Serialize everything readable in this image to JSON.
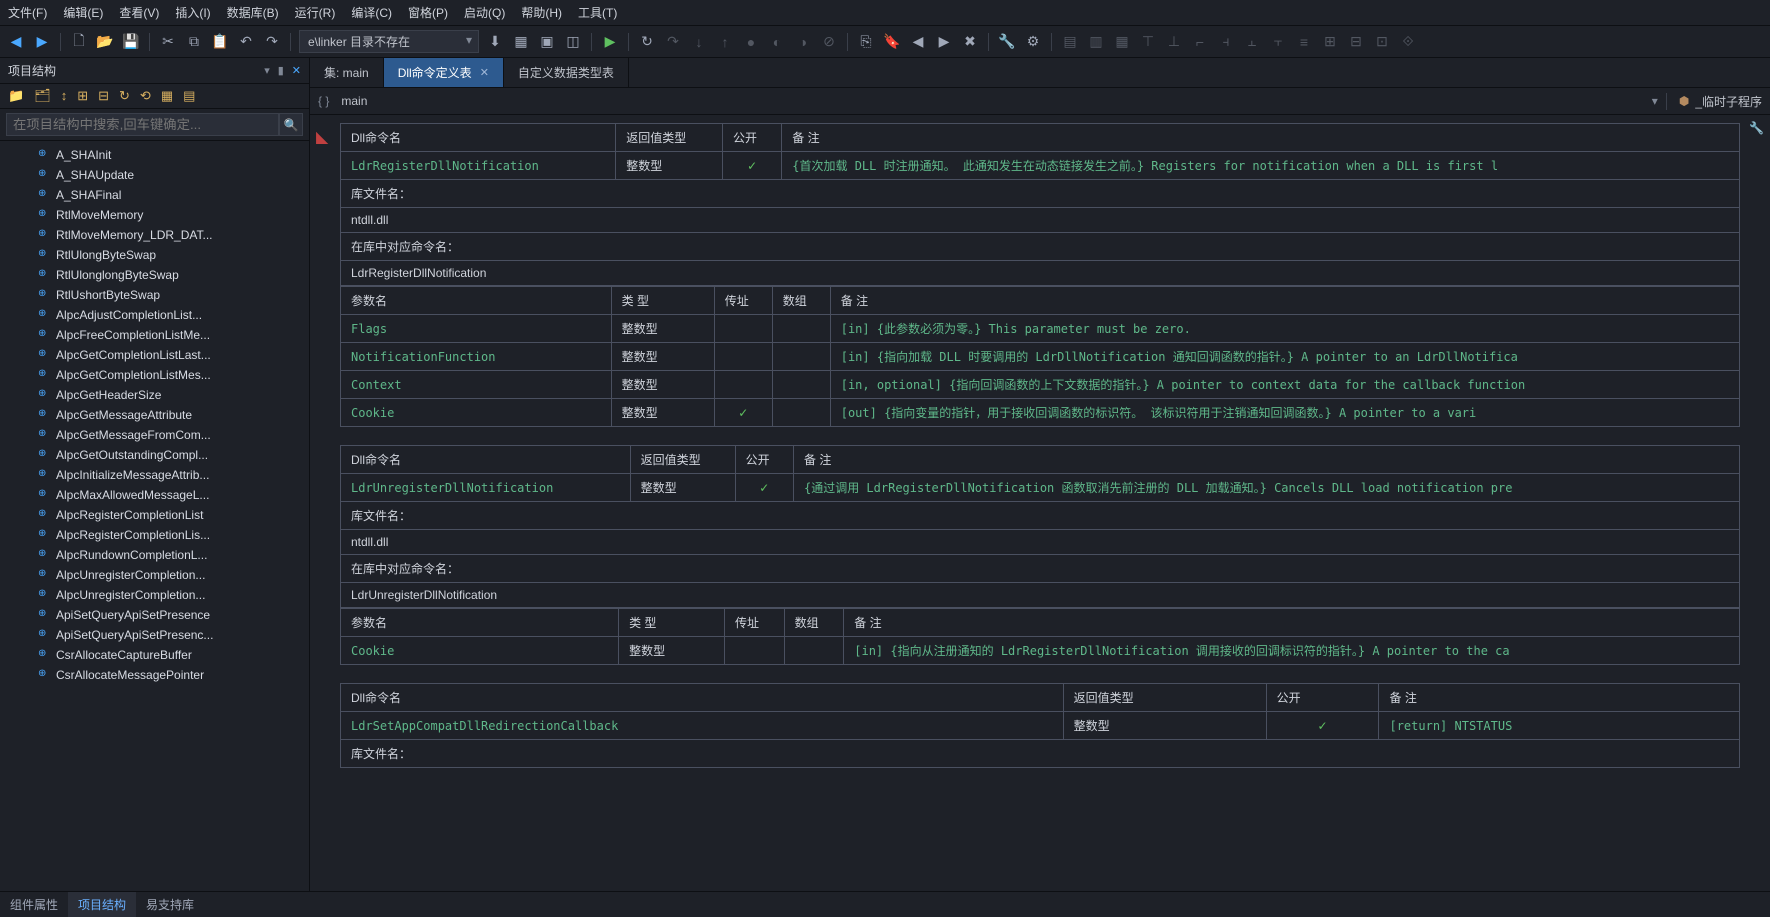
{
  "menu": [
    "文件(F)",
    "编辑(E)",
    "查看(V)",
    "插入(I)",
    "数据库(B)",
    "运行(R)",
    "编译(C)",
    "窗格(P)",
    "启动(Q)",
    "帮助(H)",
    "工具(T)"
  ],
  "toolbar": {
    "path_value": "e\\linker 目录不存在"
  },
  "sidebar": {
    "title": "项目结构",
    "search_placeholder": "在项目结构中搜索,回车键确定...",
    "items": [
      "A_SHAInit",
      "A_SHAUpdate",
      "A_SHAFinal",
      "RtlMoveMemory",
      "RtlMoveMemory_LDR_DAT...",
      "RtlUlongByteSwap",
      "RtlUlonglongByteSwap",
      "RtlUshortByteSwap",
      "AlpcAdjustCompletionList...",
      "AlpcFreeCompletionListMe...",
      "AlpcGetCompletionListLast...",
      "AlpcGetCompletionListMes...",
      "AlpcGetHeaderSize",
      "AlpcGetMessageAttribute",
      "AlpcGetMessageFromCom...",
      "AlpcGetOutstandingCompl...",
      "AlpcInitializeMessageAttrib...",
      "AlpcMaxAllowedMessageL...",
      "AlpcRegisterCompletionList",
      "AlpcRegisterCompletionLis...",
      "AlpcRundownCompletionL...",
      "AlpcUnregisterCompletion...",
      "AlpcUnregisterCompletion...",
      "ApiSetQueryApiSetPresence",
      "ApiSetQueryApiSetPresenc...",
      "CsrAllocateCaptureBuffer",
      "CsrAllocateMessagePointer"
    ]
  },
  "bottom_tabs": [
    "组件属性",
    "项目结构",
    "易支持库"
  ],
  "bottom_active": 1,
  "editor_tabs": [
    {
      "label": "集: main",
      "active": false
    },
    {
      "label": "Dll命令定义表",
      "active": true,
      "closeable": true
    },
    {
      "label": "自定义数据类型表",
      "active": false
    }
  ],
  "breadcrumb": {
    "left": "main",
    "right": "_临时子程序"
  },
  "headers": {
    "dll_name": "Dll命令名",
    "ret_type": "返回值类型",
    "public": "公开",
    "remark": "备 注",
    "lib_file": "库文件名：",
    "lib_symbol": "在库中对应命令名：",
    "param_name": "参数名",
    "param_type": "类 型",
    "by_addr": "传址",
    "array": "数组"
  },
  "blocks": [
    {
      "cmd": "LdrRegisterDllNotification",
      "ret": "整数型",
      "pub": true,
      "remark": "{首次加载 DLL 时注册通知。 此通知发生在动态链接发生之前。} Registers for notification when a DLL is first l",
      "lib": "ntdll.dll",
      "symbol": "LdrRegisterDllNotification",
      "params": [
        {
          "name": "Flags",
          "type": "整数型",
          "addr": false,
          "arr": false,
          "remark": "[in] {此参数必须为零。} This parameter must be zero."
        },
        {
          "name": "NotificationFunction",
          "type": "整数型",
          "addr": false,
          "arr": false,
          "remark": "[in] {指向加载 DLL 时要调用的 LdrDllNotification 通知回调函数的指针。} A pointer to an LdrDllNotifica"
        },
        {
          "name": "Context",
          "type": "整数型",
          "addr": false,
          "arr": false,
          "remark": "[in, optional] {指向回调函数的上下文数据的指针。} A pointer to context data for the callback function"
        },
        {
          "name": "Cookie",
          "type": "整数型",
          "addr": true,
          "arr": false,
          "remark": "[out] {指向变量的指针，用于接收回调函数的标识符。 该标识符用于注销通知回调函数。} A pointer to a vari"
        }
      ]
    },
    {
      "cmd": "LdrUnregisterDllNotification",
      "ret": "整数型",
      "pub": true,
      "remark": "{通过调用 LdrRegisterDllNotification 函数取消先前注册的 DLL 加载通知。} Cancels DLL load notification pre",
      "lib": "ntdll.dll",
      "symbol": "LdrUnregisterDllNotification",
      "params": [
        {
          "name": "Cookie",
          "type": "整数型",
          "addr": false,
          "arr": false,
          "remark": "[in] {指向从注册通知的 LdrRegisterDllNotification 调用接收的回调标识符的指针。} A pointer to the ca"
        }
      ]
    },
    {
      "cmd": "LdrSetAppCompatDllRedirectionCallback",
      "ret": "整数型",
      "pub": true,
      "remark": "[return] NTSTATUS",
      "lib": "",
      "symbol": "",
      "params": []
    }
  ]
}
